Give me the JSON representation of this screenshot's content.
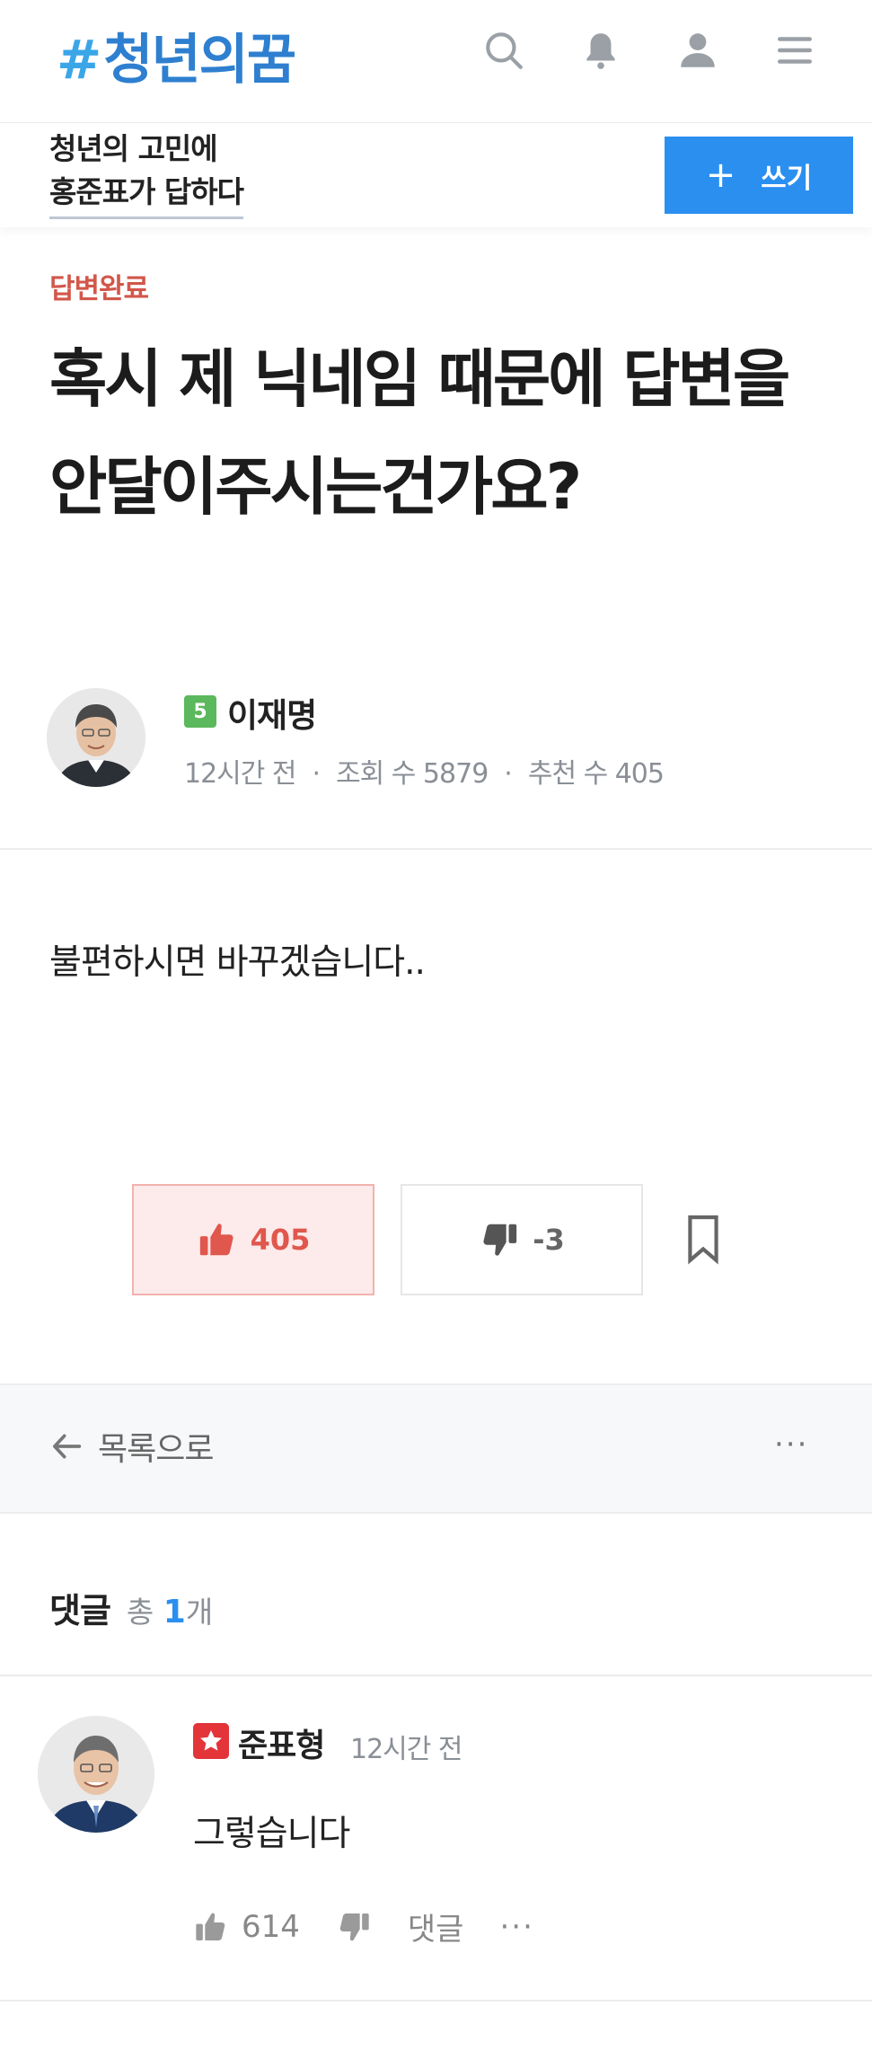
{
  "header": {
    "logo_hash": "#",
    "logo_text": "청년의꿈",
    "icons": [
      "search-icon",
      "bell-icon",
      "user-icon",
      "menu-icon"
    ]
  },
  "subheader": {
    "line1": "청년의 고민에",
    "line2": "홍준표가 답하다",
    "write_plus": "+",
    "write_label": "쓰기"
  },
  "post": {
    "status": "답변완료",
    "title": "혹시 제 닉네임 때문에 답변을 안달이주시는건가요?",
    "author": {
      "level": "5",
      "name": "이재명"
    },
    "meta": {
      "time": "12시간 전",
      "views": "조회 수 5879",
      "recommends": "추천 수 405"
    },
    "body": "불편하시면 바꾸겠습니다..",
    "upvotes": "405",
    "downvotes": "-3"
  },
  "list_nav": {
    "back_label": "목록으로",
    "more": "···"
  },
  "comments": {
    "heading": "댓글",
    "total_prefix": "총",
    "total_count": "1",
    "total_suffix": "개",
    "items": [
      {
        "name": "준표형",
        "time": "12시간 전",
        "text": "그렇습니다",
        "likes": "614",
        "reply_label": "댓글",
        "more": "···"
      }
    ]
  },
  "colors": {
    "accent": "#2b8ff0",
    "status": "#d2574b",
    "upvote": "#e0574d",
    "level_badge": "#5cb85c",
    "star_badge": "#e3343a"
  }
}
